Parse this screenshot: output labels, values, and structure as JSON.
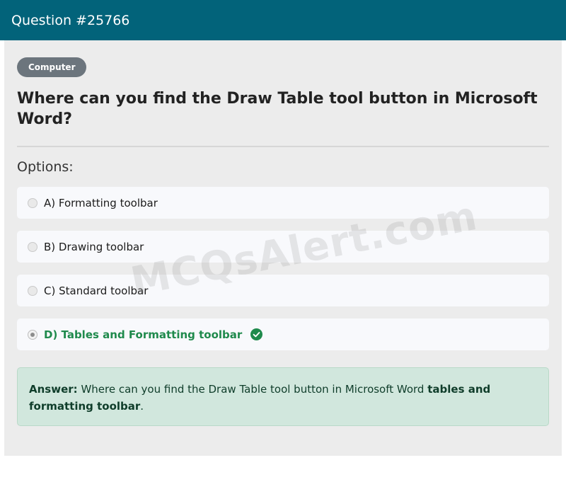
{
  "header": {
    "title": "Question #25766"
  },
  "question": {
    "category": "Computer",
    "text": "Where can you find the Draw Table tool button in Microsoft Word?",
    "options_label": "Options:",
    "options": [
      {
        "label": "A) Formatting toolbar",
        "selected": false,
        "correct": false
      },
      {
        "label": "B) Drawing toolbar",
        "selected": false,
        "correct": false
      },
      {
        "label": "C) Standard toolbar",
        "selected": false,
        "correct": false
      },
      {
        "label": "D) Tables and Formatting toolbar",
        "selected": true,
        "correct": true
      }
    ]
  },
  "answer": {
    "prefix": "Answer:",
    "text": "Where can you find the Draw Table tool button in Microsoft Word",
    "highlight": "tables and formatting toolbar",
    "suffix": "."
  },
  "watermark": "MCQsAlert.com",
  "colors": {
    "header_bg": "#02637a",
    "correct": "#1f8a4c",
    "answer_bg": "#d1e7dd"
  }
}
